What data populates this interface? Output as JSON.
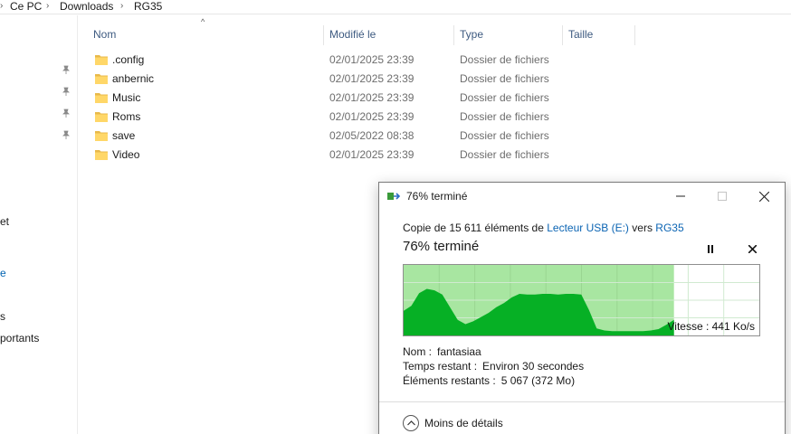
{
  "breadcrumb": {
    "items": [
      "Ce PC",
      "Downloads",
      "RG35"
    ],
    "separator": "›"
  },
  "nav": {
    "fragments": [
      "et",
      "e",
      "s",
      "portants"
    ]
  },
  "columns": {
    "name": "Nom",
    "modified": "Modifié le",
    "type": "Type",
    "size": "Taille"
  },
  "files": [
    {
      "name": ".config",
      "modified": "02/01/2025 23:39",
      "type": "Dossier de fichiers"
    },
    {
      "name": "anbernic",
      "modified": "02/01/2025 23:39",
      "type": "Dossier de fichiers"
    },
    {
      "name": "Music",
      "modified": "02/01/2025 23:39",
      "type": "Dossier de fichiers"
    },
    {
      "name": "Roms",
      "modified": "02/01/2025 23:39",
      "type": "Dossier de fichiers"
    },
    {
      "name": "save",
      "modified": "02/05/2022 08:38",
      "type": "Dossier de fichiers"
    },
    {
      "name": "Video",
      "modified": "02/01/2025 23:39",
      "type": "Dossier de fichiers"
    }
  ],
  "dialog": {
    "title": "76% terminé",
    "copy_prefix": "Copie de 15 611 éléments de",
    "source": "Lecteur USB (E:)",
    "copy_mid": "vers",
    "destination": "RG35",
    "progress_text": "76% terminé",
    "progress": 0.76,
    "speed": "Vitesse : 441 Ko/s",
    "speed_history": [
      0.35,
      0.42,
      0.6,
      0.66,
      0.64,
      0.58,
      0.4,
      0.22,
      0.16,
      0.2,
      0.26,
      0.32,
      0.4,
      0.46,
      0.54,
      0.59,
      0.58,
      0.58,
      0.59,
      0.59,
      0.58,
      0.59,
      0.59,
      0.58,
      0.36,
      0.1,
      0.07,
      0.06,
      0.06,
      0.06,
      0.06,
      0.06,
      0.07,
      0.09,
      0.15,
      0.22
    ],
    "name_label": "Nom :",
    "name_value": "fantasiaa",
    "time_label": "Temps restant :",
    "time_value": "Environ 30 secondes",
    "items_label": "Éléments restants :",
    "items_value": "5 067 (372 Mo)",
    "less_details": "Moins de détails",
    "colors": {
      "fill": "#06b025",
      "bg_done": "#a8e6a1",
      "grid": "#d0ead0"
    }
  }
}
